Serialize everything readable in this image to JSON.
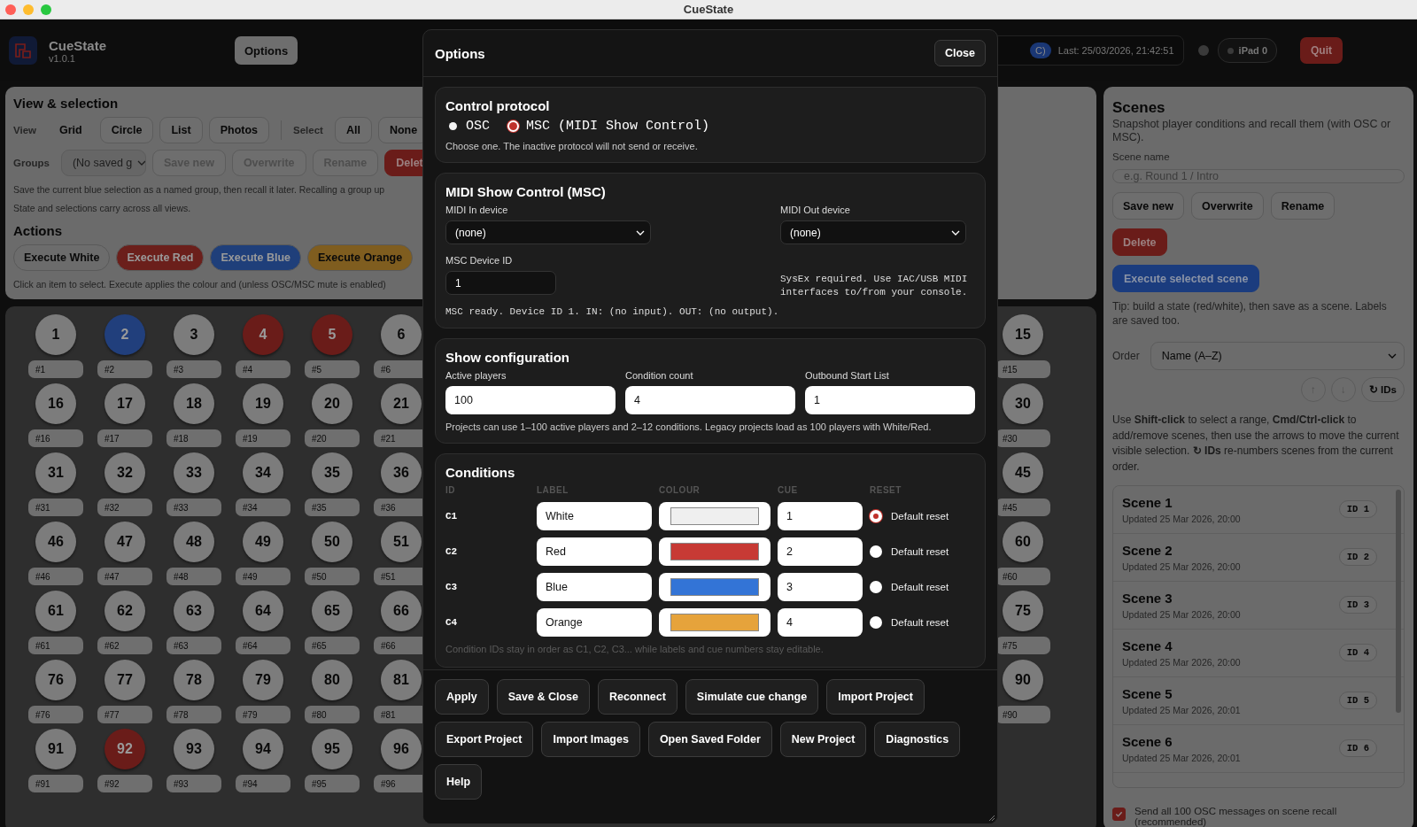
{
  "window": {
    "title": "CueState"
  },
  "topbar": {
    "app_name": "CueState",
    "version": "v1.0.1",
    "options_button": "Options",
    "status_pill": "C)",
    "last": "Last: 25/03/2026, 21:42:51",
    "device": "iPad 0",
    "quit_button": "Quit"
  },
  "view_panel": {
    "title": "View & selection",
    "view_label": "View",
    "view_modes": [
      {
        "label": "Grid",
        "selected": true
      },
      {
        "label": "Circle",
        "selected": false
      },
      {
        "label": "List",
        "selected": false
      },
      {
        "label": "Photos",
        "selected": false
      }
    ],
    "select_label": "Select",
    "select_buttons": [
      "All",
      "None"
    ],
    "groups_label": "Groups",
    "groups_select": "(No saved g",
    "group_buttons": [
      {
        "label": "Save new",
        "kind": "plain",
        "disabled": true
      },
      {
        "label": "Overwrite",
        "kind": "plain",
        "disabled": true
      },
      {
        "label": "Rename",
        "kind": "plain",
        "disabled": true
      },
      {
        "label": "Delet",
        "kind": "danger",
        "disabled": false
      }
    ],
    "help_lines": [
      "Save the current blue selection as a named group, then recall it later. Recalling a group up",
      "State and selections carry across all views."
    ]
  },
  "actions": {
    "title": "Actions",
    "buttons": [
      {
        "label": "Execute White",
        "color": "#6c6c6c"
      },
      {
        "label": "Execute Red",
        "color": "#6b1f1b"
      },
      {
        "label": "Execute Blue",
        "color": "#1f3f7a"
      },
      {
        "label": "Execute Orange",
        "color": "#7f5d1f"
      }
    ],
    "hint": "Click an item to select. Execute applies the colour and (unless OSC/MSC mute is enabled)"
  },
  "grid": {
    "rows": [
      {
        "left": [
          {
            "number": "1",
            "tag": "#1",
            "color": "#7c7c7c"
          },
          {
            "number": "2",
            "tag": "#2",
            "color": "#213f7c"
          },
          {
            "number": "3",
            "tag": "#3",
            "color": "#7c7c7c"
          },
          {
            "number": "4",
            "tag": "#4",
            "color": "#6a1c19"
          },
          {
            "number": "5",
            "tag": "#5",
            "color": "#6a1c19"
          },
          {
            "number": "6",
            "tag": "#6",
            "color": "#7c7c7c"
          }
        ],
        "right": [
          {
            "number": "15",
            "tag": "#15",
            "color": "#7c7c7c"
          }
        ]
      },
      {
        "left": [
          {
            "number": "16",
            "tag": "#16",
            "color": "#7c7c7c"
          },
          {
            "number": "17",
            "tag": "#17",
            "color": "#7c7c7c"
          },
          {
            "number": "18",
            "tag": "#18",
            "color": "#7c7c7c"
          },
          {
            "number": "19",
            "tag": "#19",
            "color": "#7c7c7c"
          },
          {
            "number": "20",
            "tag": "#20",
            "color": "#7c7c7c"
          },
          {
            "number": "21",
            "tag": "#21",
            "color": "#7c7c7c"
          }
        ],
        "right": [
          {
            "number": "30",
            "tag": "#30",
            "color": "#7c7c7c"
          }
        ]
      },
      {
        "left": [
          {
            "number": "31",
            "tag": "#31",
            "color": "#7c7c7c"
          },
          {
            "number": "32",
            "tag": "#32",
            "color": "#7c7c7c"
          },
          {
            "number": "33",
            "tag": "#33",
            "color": "#7c7c7c"
          },
          {
            "number": "34",
            "tag": "#34",
            "color": "#7c7c7c"
          },
          {
            "number": "35",
            "tag": "#35",
            "color": "#7c7c7c"
          },
          {
            "number": "36",
            "tag": "#36",
            "color": "#7c7c7c"
          }
        ],
        "right": [
          {
            "number": "45",
            "tag": "#45",
            "color": "#7c7c7c"
          }
        ]
      },
      {
        "left": [
          {
            "number": "46",
            "tag": "#46",
            "color": "#7c7c7c"
          },
          {
            "number": "47",
            "tag": "#47",
            "color": "#7c7c7c"
          },
          {
            "number": "48",
            "tag": "#48",
            "color": "#7c7c7c"
          },
          {
            "number": "49",
            "tag": "#49",
            "color": "#7c7c7c"
          },
          {
            "number": "50",
            "tag": "#50",
            "color": "#7c7c7c"
          },
          {
            "number": "51",
            "tag": "#51",
            "color": "#7c7c7c"
          }
        ],
        "right": [
          {
            "number": "60",
            "tag": "#60",
            "color": "#7c7c7c"
          }
        ]
      },
      {
        "left": [
          {
            "number": "61",
            "tag": "#61",
            "color": "#7c7c7c"
          },
          {
            "number": "62",
            "tag": "#62",
            "color": "#7c7c7c"
          },
          {
            "number": "63",
            "tag": "#63",
            "color": "#7c7c7c"
          },
          {
            "number": "64",
            "tag": "#64",
            "color": "#7c7c7c"
          },
          {
            "number": "65",
            "tag": "#65",
            "color": "#7c7c7c"
          },
          {
            "number": "66",
            "tag": "#66",
            "color": "#7c7c7c"
          }
        ],
        "right": [
          {
            "number": "75",
            "tag": "#75",
            "color": "#7c7c7c"
          }
        ]
      },
      {
        "left": [
          {
            "number": "76",
            "tag": "#76",
            "color": "#7c7c7c"
          },
          {
            "number": "77",
            "tag": "#77",
            "color": "#7c7c7c"
          },
          {
            "number": "78",
            "tag": "#78",
            "color": "#7c7c7c"
          },
          {
            "number": "79",
            "tag": "#79",
            "color": "#7c7c7c"
          },
          {
            "number": "80",
            "tag": "#80",
            "color": "#7c7c7c"
          },
          {
            "number": "81",
            "tag": "#81",
            "color": "#7c7c7c"
          }
        ],
        "right": [
          {
            "number": "90",
            "tag": "#90",
            "color": "#7c7c7c"
          }
        ]
      },
      {
        "left": [
          {
            "number": "91",
            "tag": "#91",
            "color": "#7c7c7c"
          },
          {
            "number": "92",
            "tag": "#92",
            "color": "#6a1c19"
          },
          {
            "number": "93",
            "tag": "#93",
            "color": "#7c7c7c"
          },
          {
            "number": "94",
            "tag": "#94",
            "color": "#7c7c7c"
          },
          {
            "number": "95",
            "tag": "#95",
            "color": "#7c7c7c"
          },
          {
            "number": "96",
            "tag": "#96",
            "color": "#7c7c7c"
          }
        ],
        "right": []
      }
    ]
  },
  "scenes": {
    "title": "Scenes",
    "subtitle": "Snapshot player conditions and recall them (with OSC or MSC).",
    "name_label": "Scene name",
    "name_placeholder": "e.g. Round 1 / Intro",
    "buttons": [
      {
        "label": "Save new",
        "kind": "plain"
      },
      {
        "label": "Overwrite",
        "kind": "plain"
      },
      {
        "label": "Rename",
        "kind": "plain"
      },
      {
        "label": "Delete",
        "kind": "danger"
      },
      {
        "label": "Execute selected scene",
        "kind": "primary"
      }
    ],
    "tip": "Tip: build a state (red/white), then save as a scene. Labels are saved too.",
    "order_label": "Order",
    "order_value": "Name (A–Z)",
    "move_buttons": [
      {
        "label": "↑",
        "disabled": true
      },
      {
        "label": "↓",
        "disabled": true
      },
      {
        "label": "↻ IDs",
        "disabled": false
      }
    ],
    "help": "Use **Shift-click** to select a range, **Cmd/Ctrl-click** to add/remove scenes, then use the arrows to move the current visible selection. **↻ IDs** re-numbers scenes from the current order.",
    "items": [
      {
        "name": "Scene 1",
        "updated": "Updated 25 Mar 2026, 20:00",
        "id": "ID 1"
      },
      {
        "name": "Scene 2",
        "updated": "Updated 25 Mar 2026, 20:00",
        "id": "ID 2"
      },
      {
        "name": "Scene 3",
        "updated": "Updated 25 Mar 2026, 20:00",
        "id": "ID 3"
      },
      {
        "name": "Scene 4",
        "updated": "Updated 25 Mar 2026, 20:00",
        "id": "ID 4"
      },
      {
        "name": "Scene 5",
        "updated": "Updated 25 Mar 2026, 20:01",
        "id": "ID 5"
      },
      {
        "name": "Scene 6",
        "updated": "Updated 25 Mar 2026, 20:01",
        "id": "ID 6"
      }
    ],
    "recall_all": {
      "label": "Send all 100 OSC messages on scene recall (recommended)",
      "checked": true
    }
  },
  "modal": {
    "title": "Options",
    "close_button": "Close",
    "protocol": {
      "title": "Control protocol",
      "options": [
        {
          "label": "OSC",
          "selected": false
        },
        {
          "label": "MSC (MIDI Show Control)",
          "selected": true
        }
      ],
      "note": "Choose one. The inactive protocol will not send or receive."
    },
    "msc": {
      "title": "MIDI Show Control (MSC)",
      "midi_in_label": "MIDI In device",
      "midi_in_value": "(none)",
      "midi_out_label": "MIDI Out device",
      "midi_out_value": "(none)",
      "device_id_label": "MSC Device ID",
      "device_id_value": "1",
      "sysex_note": "SysEx required. Use IAC/USB MIDI interfaces to/from your console.",
      "status": "MSC ready. Device ID 1. IN: (no input). OUT: (no output)."
    },
    "show_config": {
      "title": "Show configuration",
      "fields": [
        {
          "label": "Active players",
          "value": "100"
        },
        {
          "label": "Condition count",
          "value": "4"
        },
        {
          "label": "Outbound Start List",
          "value": "1"
        }
      ],
      "note": "Projects can use 1–100 active players and 2–12 conditions. Legacy projects load as 100 players with White/Red."
    },
    "conditions": {
      "title": "Conditions",
      "columns": [
        "ID",
        "LABEL",
        "COLOUR",
        "CUE",
        "RESET"
      ],
      "rows": [
        {
          "id": "C1",
          "label": "White",
          "color": "#efefef",
          "cue": "1",
          "reset_label": "Default reset",
          "reset_selected": true
        },
        {
          "id": "C2",
          "label": "Red",
          "color": "#c73a35",
          "cue": "2",
          "reset_label": "Default reset",
          "reset_selected": false
        },
        {
          "id": "C3",
          "label": "Blue",
          "color": "#3374d6",
          "cue": "3",
          "reset_label": "Default reset",
          "reset_selected": false
        },
        {
          "id": "C4",
          "label": "Orange",
          "color": "#e6a33b",
          "cue": "4",
          "reset_label": "Default reset",
          "reset_selected": false
        }
      ],
      "note": "Condition IDs stay in order as C1, C2, C3... while labels and cue numbers stay editable."
    },
    "footer_rows": [
      [
        "Apply",
        "Save & Close",
        "Reconnect",
        "Simulate cue change",
        "Import Project"
      ],
      [
        "Export Project",
        "Import Images",
        "Open Saved Folder",
        "New Project",
        "Diagnostics"
      ],
      [
        "Help"
      ]
    ]
  }
}
